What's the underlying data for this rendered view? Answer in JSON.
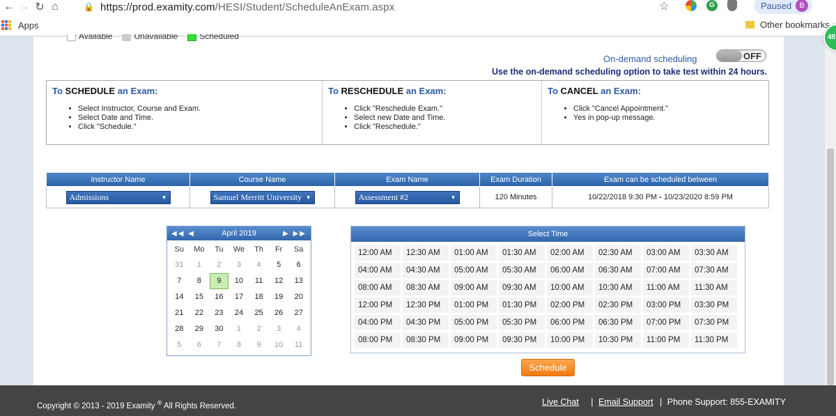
{
  "browser": {
    "url_host": "https://prod.examity.com",
    "url_path": "/HESI/Student/ScheduleAnExam.aspx",
    "paused_label": "Paused",
    "avatar_letter": "B",
    "apps_label": "Apps",
    "other_bookmarks": "Other bookmarks",
    "badge_number": "48"
  },
  "legend": {
    "available": "Available",
    "unavailable": "Unavailable",
    "scheduled": "Scheduled",
    "colors": {
      "available": "#ffffff",
      "unavailable": "#cccccc",
      "scheduled": "#33dd33"
    }
  },
  "ondemand": {
    "label": "On-demand scheduling",
    "toggle_state": "OFF",
    "note": "Use the on-demand scheduling option to take test within 24 hours."
  },
  "instructions": {
    "schedule": {
      "prefix": "To",
      "keyword": "SCHEDULE",
      "suffix": "an Exam:",
      "steps": [
        "Select Instructor, Course and Exam.",
        "Select Date and Time.",
        "Click \"Schedule.\""
      ]
    },
    "reschedule": {
      "prefix": "To",
      "keyword": "RESCHEDULE",
      "suffix": "an Exam:",
      "steps": [
        "Click \"Reschedule Exam.\"",
        "Select new Date and Time.",
        "Click \"Reschedule.\""
      ]
    },
    "cancel": {
      "prefix": "To",
      "keyword": "CANCEL",
      "suffix": "an Exam:",
      "steps": [
        "Click \"Cancel Appointment.\"",
        "Yes in pop-up message."
      ]
    }
  },
  "exam_table": {
    "headers": [
      "Instructor Name",
      "Course Name",
      "Exam Name",
      "Exam Duration",
      "Exam can be scheduled between"
    ],
    "instructor": "Admissions",
    "course": "Samuel Merritt University",
    "exam": "Assessment #2",
    "duration": "120 Minutes",
    "window_start": "10/22/2018 9:30 PM",
    "window_sep": "-",
    "window_end": "10/23/2020 8:59 PM"
  },
  "calendar": {
    "month_label": "April 2019",
    "prev_year": "◀◀",
    "prev": "◀",
    "next": "▶",
    "next_year": "▶▶",
    "days_of_week": [
      "Su",
      "Mo",
      "Tu",
      "We",
      "Th",
      "Fr",
      "Sa"
    ],
    "weeks": [
      [
        "31",
        "1",
        "2",
        "3",
        "4",
        "5",
        "6"
      ],
      [
        "7",
        "8",
        "9",
        "10",
        "11",
        "12",
        "13"
      ],
      [
        "14",
        "15",
        "16",
        "17",
        "18",
        "19",
        "20"
      ],
      [
        "21",
        "22",
        "23",
        "24",
        "25",
        "26",
        "27"
      ],
      [
        "28",
        "29",
        "30",
        "1",
        "2",
        "3",
        "4"
      ],
      [
        "5",
        "6",
        "7",
        "8",
        "9",
        "10",
        "11"
      ]
    ],
    "other_month_cells": [
      "0-0",
      "0-1",
      "0-2",
      "0-3",
      "0-4",
      "4-3",
      "4-4",
      "4-5",
      "4-6",
      "5-0",
      "5-1",
      "5-2",
      "5-3",
      "5-4",
      "5-5",
      "5-6"
    ],
    "selected_cell": "1-2"
  },
  "time_select": {
    "header": "Select Time",
    "slots": [
      "12:00 AM",
      "12:30 AM",
      "01:00 AM",
      "01:30 AM",
      "02:00 AM",
      "02:30 AM",
      "03:00 AM",
      "03:30 AM",
      "04:00 AM",
      "04:30 AM",
      "05:00 AM",
      "05:30 AM",
      "06:00 AM",
      "06:30 AM",
      "07:00 AM",
      "07:30 AM",
      "08:00 AM",
      "08:30 AM",
      "09:00 AM",
      "09:30 AM",
      "10:00 AM",
      "10:30 AM",
      "11:00 AM",
      "11:30 AM",
      "12:00 PM",
      "12:30 PM",
      "01:00 PM",
      "01:30 PM",
      "02:00 PM",
      "02:30 PM",
      "03:00 PM",
      "03:30 PM",
      "04:00 PM",
      "04:30 PM",
      "05:00 PM",
      "05:30 PM",
      "06:00 PM",
      "06:30 PM",
      "07:00 PM",
      "07:30 PM",
      "08:00 PM",
      "08:30 PM",
      "09:00 PM",
      "09:30 PM",
      "10:00 PM",
      "10:30 PM",
      "11:00 PM",
      "11:30 PM"
    ]
  },
  "schedule_button": "Schedule",
  "footer": {
    "copyright": "Copyright © 2013 - 2019 Examity",
    "reg": "®",
    "rights": "All Rights Reserved.",
    "live_chat": "Live Chat",
    "sep": "|",
    "email_support": "Email Support",
    "phone_support": "Phone Support: 855-EXAMITY"
  }
}
